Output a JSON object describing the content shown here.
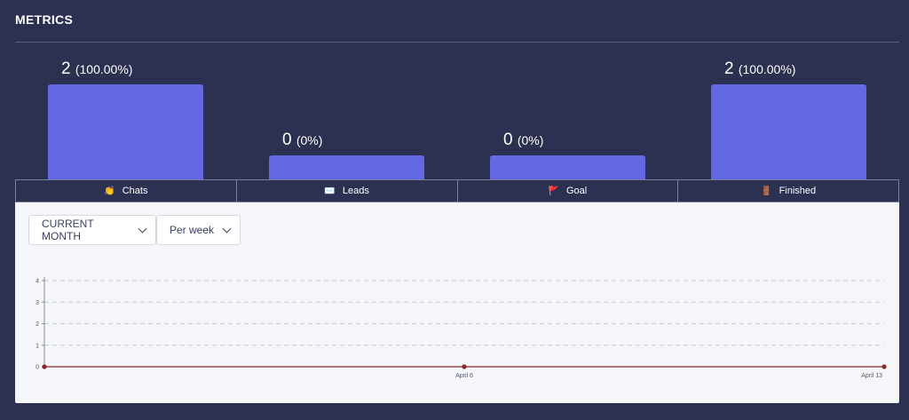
{
  "header": {
    "title": "METRICS"
  },
  "metrics": [
    {
      "count": "2",
      "percent": "(100.00%)",
      "fraction": 1.0
    },
    {
      "count": "0",
      "percent": "(0%)",
      "fraction": 0.0
    },
    {
      "count": "0",
      "percent": "(0%)",
      "fraction": 0.0
    },
    {
      "count": "2",
      "percent": "(100.00%)",
      "fraction": 1.0
    }
  ],
  "tabs": [
    {
      "label": "Chats",
      "emoji": "👏",
      "icon": "clap-icon"
    },
    {
      "label": "Leads",
      "emoji": "✉️",
      "icon": "envelope-icon"
    },
    {
      "label": "Goal",
      "emoji": "🚩",
      "icon": "flag-icon"
    },
    {
      "label": "Finished",
      "emoji": "🚪",
      "icon": "door-icon"
    }
  ],
  "filters": {
    "period": {
      "value": "CURRENT MONTH"
    },
    "granularity": {
      "value": "Per week"
    }
  },
  "chart_data": {
    "type": "line",
    "x": [
      "",
      "April 6",
      "April 13"
    ],
    "series": [
      {
        "values": [
          0,
          0,
          0
        ]
      }
    ],
    "ylim": [
      0,
      4
    ],
    "yticks": [
      "0",
      "1",
      "2",
      "3",
      "4"
    ],
    "grid": true,
    "colors": {
      "line": "#8b2a2a",
      "grid": "#c9cbd4"
    }
  }
}
